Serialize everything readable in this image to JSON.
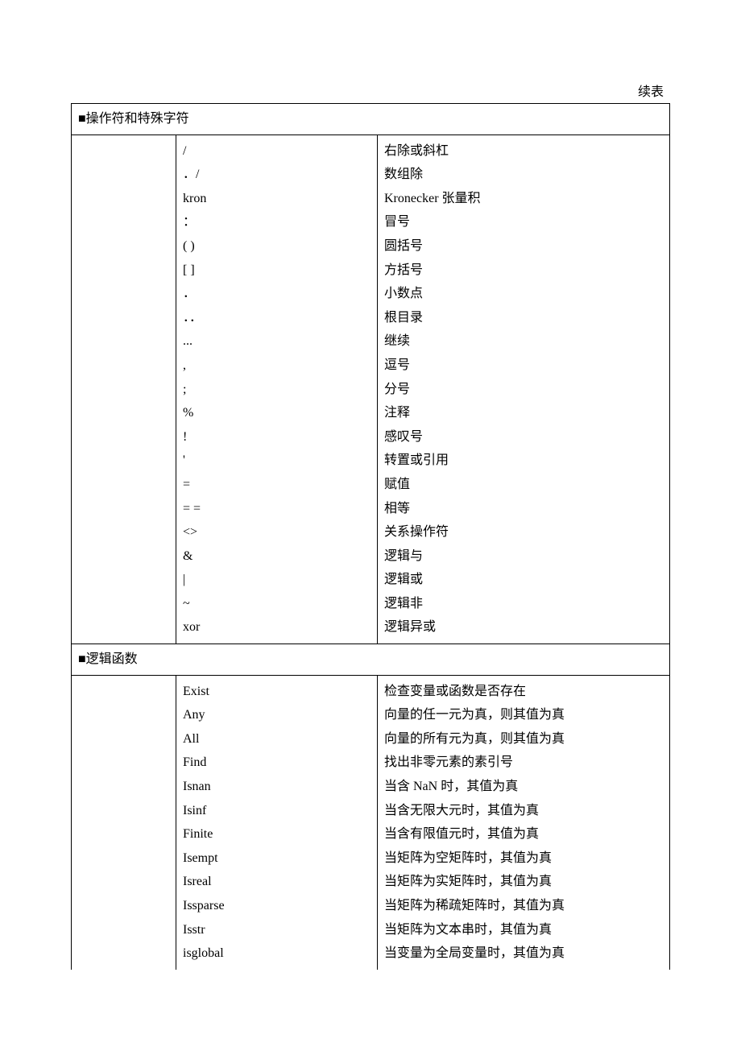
{
  "top_label": "续表",
  "sections": [
    {
      "title": "■操作符和特殊字符",
      "rows": [
        {
          "sym": "/",
          "desc": "右除或斜杠"
        },
        {
          "sym": "．/",
          "desc": "数组除"
        },
        {
          "sym": "kron",
          "desc": "Kronecker 张量积"
        },
        {
          "sym": "：",
          "desc": "冒号"
        },
        {
          "sym": "( )",
          "desc": "圆括号"
        },
        {
          "sym": "[ ]",
          "desc": "方括号"
        },
        {
          "sym": "．",
          "desc": "小数点"
        },
        {
          "sym": "．．",
          "desc": "根目录"
        },
        {
          "sym": "...",
          "desc": "继续"
        },
        {
          "sym": ",",
          "desc": "逗号"
        },
        {
          "sym": ";",
          "desc": "分号"
        },
        {
          "sym": "%",
          "desc": "注释"
        },
        {
          "sym": "!",
          "desc": "感叹号"
        },
        {
          "sym": "'",
          "desc": "转置或引用"
        },
        {
          "sym": "=",
          "desc": "赋值"
        },
        {
          "sym": "= =",
          "desc": "相等"
        },
        {
          "sym": "<>",
          "desc": "关系操作符"
        },
        {
          "sym": "&",
          "desc": "逻辑与"
        },
        {
          "sym": "|",
          "desc": "逻辑或"
        },
        {
          "sym": "~",
          "desc": "逻辑非"
        },
        {
          "sym": "xor",
          "desc": "逻辑异或"
        }
      ]
    },
    {
      "title": "■逻辑函数",
      "rows": [
        {
          "sym": "Exist",
          "desc": "检查变量或函数是否存在"
        },
        {
          "sym": "Any",
          "desc": "向量的任一元为真，则其值为真"
        },
        {
          "sym": "All",
          "desc": "向量的所有元为真，则其值为真"
        },
        {
          "sym": "Find",
          "desc": "找出非零元素的素引号"
        },
        {
          "sym": "Isnan",
          "desc": "当含 NaN 时，其值为真"
        },
        {
          "sym": "Isinf",
          "desc": "当含无限大元时，其值为真"
        },
        {
          "sym": "Finite",
          "desc": "当含有限值元时，其值为真"
        },
        {
          "sym": "Isempt",
          "desc": "当矩阵为空矩阵时，其值为真"
        },
        {
          "sym": "Isreal",
          "desc": "当矩阵为实矩阵时，其值为真"
        },
        {
          "sym": "Issparse",
          "desc": "当矩阵为稀疏矩阵时，其值为真"
        },
        {
          "sym": "Isstr",
          "desc": "当矩阵为文本串时，其值为真"
        },
        {
          "sym": "isglobal",
          "desc": "当变量为全局变量时，其值为真"
        }
      ]
    }
  ]
}
